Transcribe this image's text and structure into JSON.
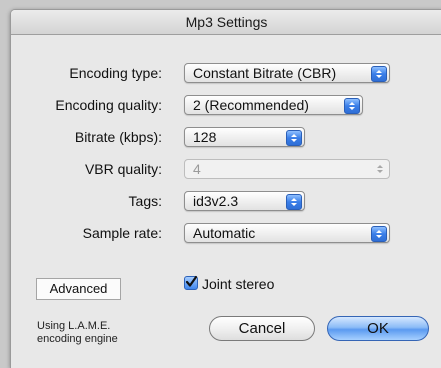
{
  "window": {
    "title": "Mp3 Settings"
  },
  "rows": [
    {
      "label": "Encoding type:",
      "value": "Constant Bitrate (CBR)",
      "enabled": true
    },
    {
      "label": "Encoding quality:",
      "value": "2 (Recommended)",
      "enabled": true
    },
    {
      "label": "Bitrate (kbps):",
      "value": "128",
      "enabled": true
    },
    {
      "label": "VBR quality:",
      "value": "4",
      "enabled": false
    },
    {
      "label": "Tags:",
      "value": "id3v2.3",
      "enabled": true
    },
    {
      "label": "Sample rate:",
      "value": "Automatic",
      "enabled": true
    }
  ],
  "advanced_button": "Advanced",
  "joint_stereo": {
    "label": "Joint stereo",
    "checked": true
  },
  "footnote": {
    "line1": "Using L.A.M.E.",
    "line2": "encoding engine"
  },
  "buttons": {
    "cancel": "Cancel",
    "ok": "OK"
  },
  "colors": {
    "accent": "#3a7ee8",
    "window_bg": "#e8e8e8"
  },
  "icons": {
    "popup_stepper": "up-down-arrows-icon",
    "checkbox": "checkmark-icon"
  }
}
